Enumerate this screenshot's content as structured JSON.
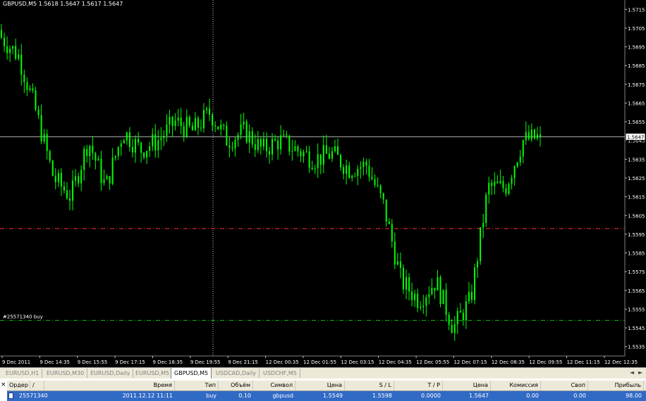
{
  "symbol_info": "GBPUSD,M5  1.5618 1.5647 1.5617 1.5647",
  "colors": {
    "bg": "#000000",
    "candle": "#00ff00",
    "grid": "#1e3a1e",
    "axis_text": "#ffffff",
    "sl_line": "#ff3030",
    "order_line": "#00c000"
  },
  "chart_data": {
    "type": "line",
    "x": [
      "9 Dec 2011",
      "9 Dec 14:35",
      "9 Dec 15:55",
      "9 Dec 17:15",
      "9 Dec 18:35",
      "9 Dec 19:55",
      "9 Dec 21:15",
      "12 Dec 00:35",
      "12 Dec 01:55",
      "12 Dec 03:15",
      "12 Dec 04:35",
      "12 Dec 05:55",
      "12 Dec 07:15",
      "12 Dec 08:35",
      "12 Dec 09:55",
      "12 Dec 11:15",
      "12 Dec 12:35"
    ],
    "y_ticks": [
      "1.5715",
      "1.5705",
      "1.5695",
      "1.5685",
      "1.5675",
      "1.5665",
      "1.5655",
      "1.5645",
      "1.5635",
      "1.5625",
      "1.5615",
      "1.5605",
      "1.5595",
      "1.5585",
      "1.5575",
      "1.5565",
      "1.5555",
      "1.5545",
      "1.5535"
    ],
    "ylim": [
      1.553,
      1.572
    ],
    "series": [
      {
        "values": [
          1.57,
          1.569,
          1.566,
          1.5625,
          1.5615,
          1.5645,
          1.562,
          1.565,
          1.564,
          1.5645,
          1.5655,
          1.565,
          1.566,
          1.5645,
          1.565,
          1.564,
          1.5645,
          1.564,
          1.5635,
          1.5638,
          1.563,
          1.5632,
          1.561,
          1.557,
          1.556,
          1.557,
          1.5545,
          1.556,
          1.562,
          1.562,
          1.5645,
          1.5647
        ]
      }
    ],
    "current_price": "1.5647",
    "current_price_value": 1.5647,
    "sl_level": 1.5598,
    "order_level": 1.5549,
    "order_label": "#25571340 buy"
  },
  "tabs": [
    {
      "label": "EURUSD,H1"
    },
    {
      "label": "EURUSD,M30"
    },
    {
      "label": "EURUSD,Daily"
    },
    {
      "label": "EURUSD,M5"
    },
    {
      "label": "GBPUSD,M5"
    },
    {
      "label": "USDCAD,Daily"
    },
    {
      "label": "USDCHF,M5"
    }
  ],
  "terminal": {
    "close_glyph": "×",
    "headers": {
      "order": "Ордер",
      "sort": "/",
      "time": "Время",
      "type": "Тип",
      "volume": "Объём",
      "symbol": "Символ",
      "price": "Цена",
      "sl": "S / L",
      "tp": "T / P",
      "price2": "Цена",
      "commission": "Комиссия",
      "swap": "Своп",
      "profit": "Прибыль"
    },
    "row": {
      "order": "25571340",
      "time": "2011.12.12 11:11",
      "type": "buy",
      "volume": "0.10",
      "symbol": "gbpusd",
      "price": "1.5549",
      "sl": "1.5598",
      "tp": "0.0000",
      "price2": "1.5647",
      "commission": "0.00",
      "swap": "0.00",
      "profit": "98.00"
    }
  }
}
